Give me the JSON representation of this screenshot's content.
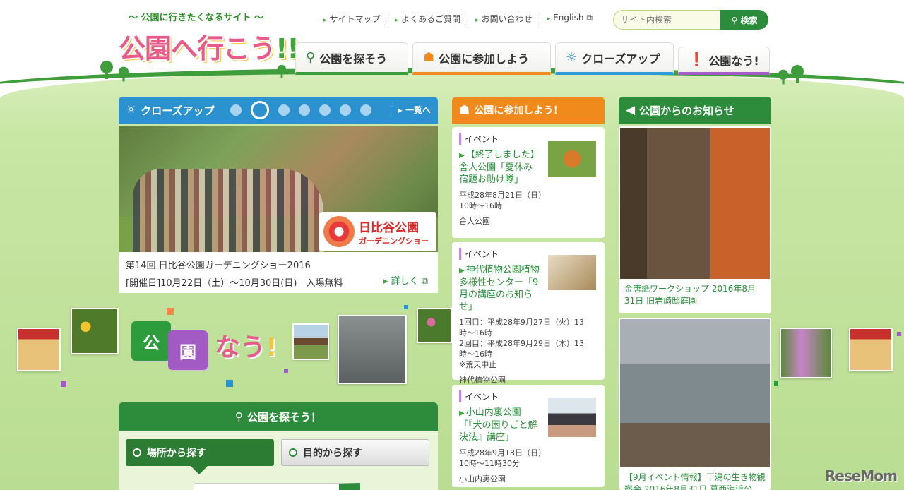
{
  "header": {
    "tagline": "〜 公園に行きたくなるサイト 〜",
    "logo_main": "公園へ行こう",
    "logo_ex": "!!",
    "util_nav": [
      "サイトマップ",
      "よくあるご質問",
      "お問い合わせ",
      "English ⧉"
    ],
    "search": {
      "placeholder": "サイト内検索",
      "button": "検索"
    },
    "tabs": [
      "公園を探そう",
      "公園に参加しよう",
      "クローズアップ",
      "公園なう!"
    ]
  },
  "closeup": {
    "title": "クローズアップ",
    "list_link": "一覧へ",
    "badge_line1": "日比谷公園",
    "badge_line2": "ガーデニングショー",
    "caption_line1": "第14回 日比谷公園ガーデニングショー2016",
    "caption_line2": "[開催日]10月22日（土）〜10月30日(日)　入場無料",
    "more": "詳しく ⧉"
  },
  "participate": {
    "title": "公園に参加しよう！",
    "events": [
      {
        "tag": "イベント",
        "title": "【終了しました】舎人公園「夏休み宿題お助け隊」",
        "dates": [
          "平成28年8月21日（日）",
          "10時〜16時"
        ],
        "place": "舎人公園"
      },
      {
        "tag": "イベント",
        "title": "神代植物公園植物多様性センター「9月の講座のお知らせ」",
        "dates": [
          "1回目：平成28年9月27日（火）13時〜16時",
          "2回目：平成28年9月29日（木）13時〜16時",
          "※荒天中止"
        ],
        "place": "神代植物公園"
      },
      {
        "tag": "イベント",
        "title": "小山内裏公園「『犬の困りごと解決法』講座」",
        "dates": [
          "平成28年9月18日（日）",
          "10時〜11時30分"
        ],
        "place": "小山内裏公園"
      }
    ]
  },
  "notice": {
    "title": "公園からのお知らせ",
    "items": [
      {
        "caption": "金唐紙ワークショップ 2016年8月31日 旧岩崎邸庭園"
      },
      {
        "caption": "【9月イベント情報】干潟の生き物観察会 2016年8月31日 葛西海浜公"
      }
    ]
  },
  "nau": {
    "box1": "公",
    "box2": "園",
    "text": "なう",
    "ex": "!"
  },
  "park_search": {
    "title": "公園を探そう！",
    "tab_place": "場所から探す",
    "tab_purpose": "目的から探す"
  },
  "watermark": "ReseMom",
  "colors": {
    "green": "#2c8c3c",
    "orange": "#f08a1c",
    "blue": "#2c91cf",
    "purple": "#a25bc4",
    "pink": "#e85a8a"
  }
}
